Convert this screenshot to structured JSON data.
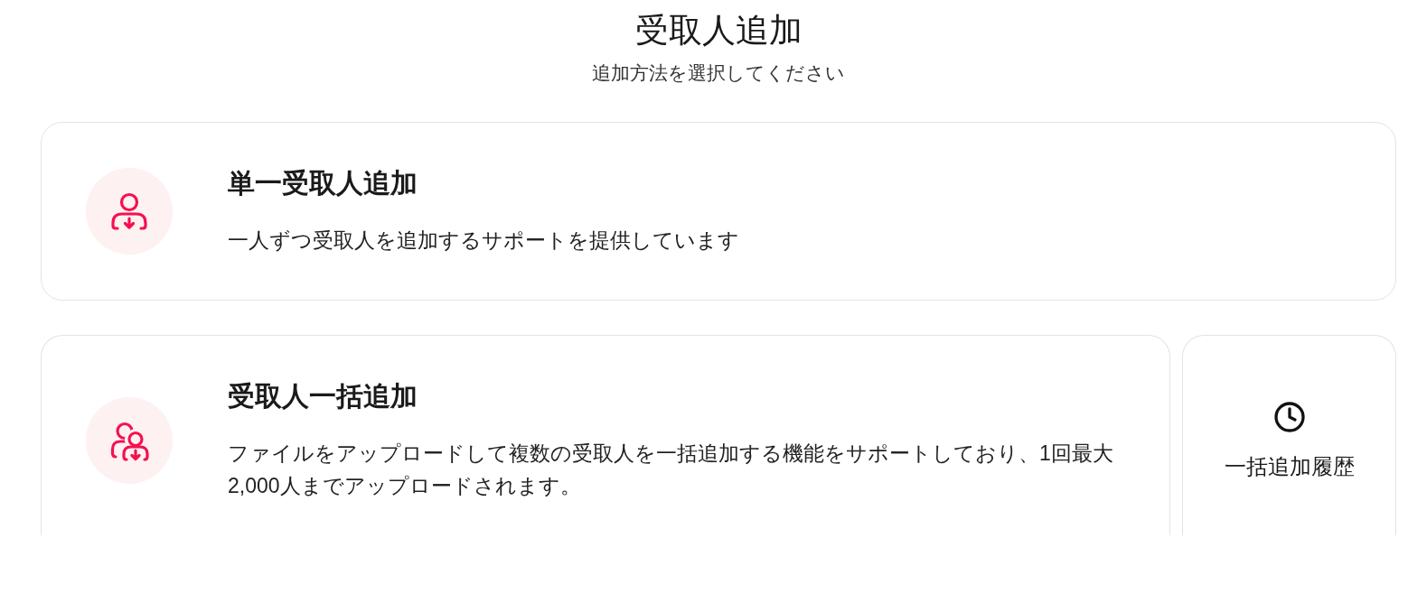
{
  "header": {
    "title": "受取人追加",
    "subtitle": "追加方法を選択してください"
  },
  "options": [
    {
      "kind": "single",
      "title": "単一受取人追加",
      "description": "一人ずつ受取人を追加するサポートを提供しています"
    },
    {
      "kind": "bulk",
      "title": "受取人一括追加",
      "description": "ファイルをアップロードして複数の受取人を一括追加する機能をサポートしており、1回最大2,000人までアップロードされます。"
    }
  ],
  "history_button": {
    "label": "一括追加履歴"
  }
}
